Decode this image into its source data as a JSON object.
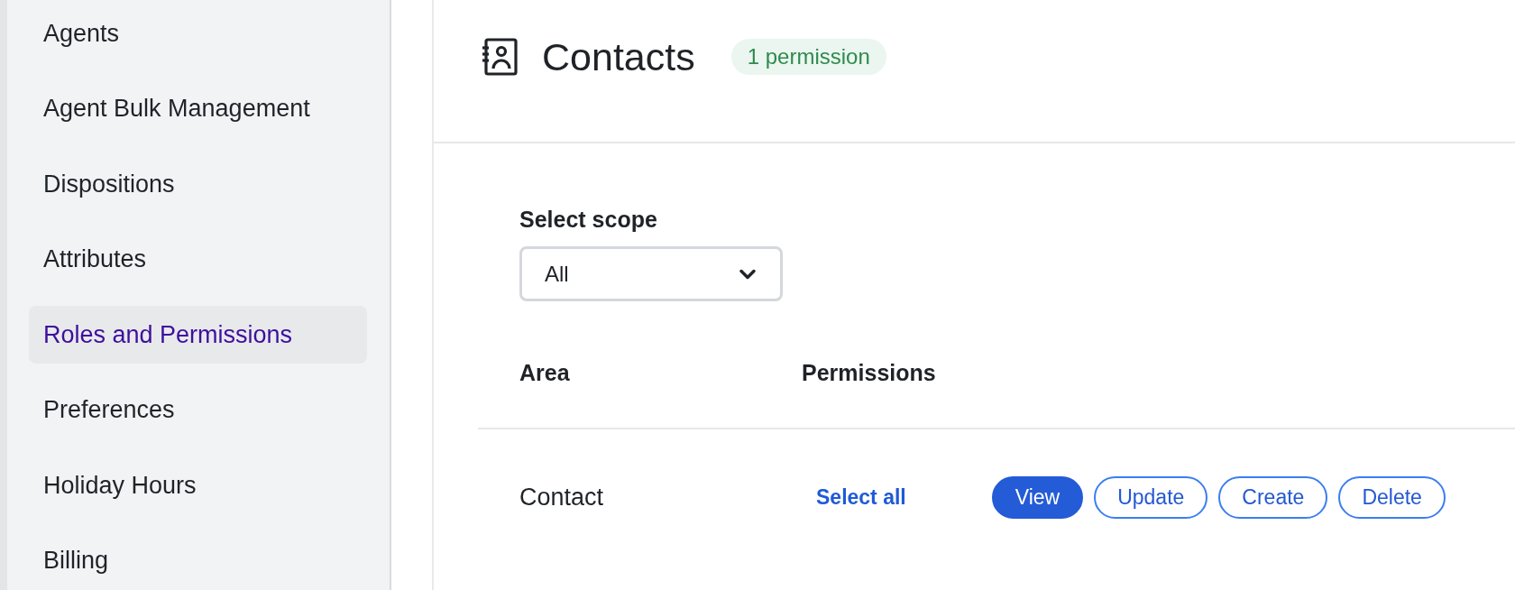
{
  "sidebar": {
    "items": [
      {
        "label": "Agents",
        "selected": false
      },
      {
        "label": "Agent Bulk Management",
        "selected": false
      },
      {
        "label": "Dispositions",
        "selected": false
      },
      {
        "label": "Attributes",
        "selected": false
      },
      {
        "label": "Roles and Permissions",
        "selected": true
      },
      {
        "label": "Preferences",
        "selected": false
      },
      {
        "label": "Holiday Hours",
        "selected": false
      },
      {
        "label": "Billing",
        "selected": false
      }
    ]
  },
  "header": {
    "title": "Contacts",
    "badge": "1 permission"
  },
  "scope": {
    "label": "Select scope",
    "value": "All"
  },
  "table": {
    "columns": [
      "Area",
      "Permissions"
    ],
    "rows": [
      {
        "area": "Contact",
        "select_all": "Select all",
        "permissions": [
          {
            "label": "View",
            "selected": true
          },
          {
            "label": "Update",
            "selected": false
          },
          {
            "label": "Create",
            "selected": false
          },
          {
            "label": "Delete",
            "selected": false
          }
        ]
      }
    ]
  }
}
